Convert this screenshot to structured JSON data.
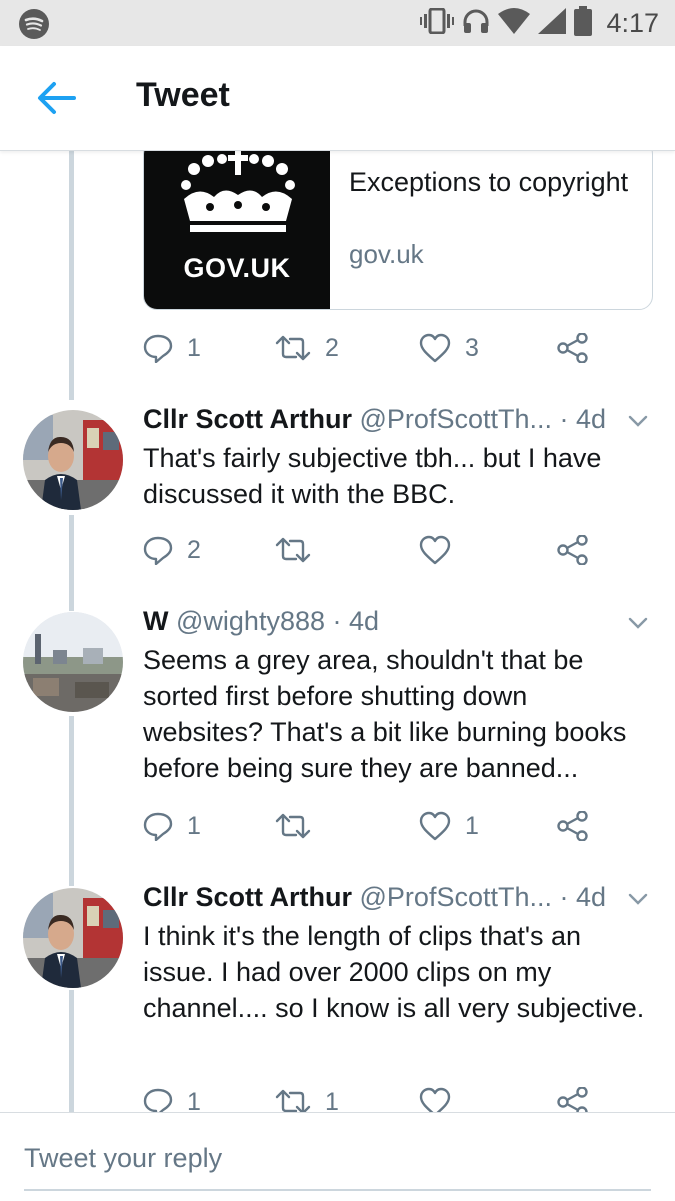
{
  "status_bar": {
    "time": "4:17"
  },
  "app_bar": {
    "title": "Tweet"
  },
  "link_card": {
    "thumbnail_text": "GOV.UK",
    "title": "Exceptions to copyright",
    "domain": "gov.uk",
    "actions": {
      "reply_count": "1",
      "retweet_count": "2",
      "like_count": "3"
    }
  },
  "tweets": [
    {
      "name": "Cllr Scott Arthur",
      "handle": "@ProfScottTh...",
      "time": " · 4d",
      "text": "That's fairly subjective tbh... but I have discussed it with the BBC.",
      "reply_count": "2",
      "retweet_count": "",
      "like_count": ""
    },
    {
      "name": "W",
      "handle": "@wighty888",
      "time": " · 4d",
      "text": "Seems a grey area, shouldn't that be sorted first before shutting down websites? That's a bit like burning books before being sure they are banned...",
      "reply_count": "1",
      "retweet_count": "",
      "like_count": "1"
    },
    {
      "name": "Cllr Scott Arthur",
      "handle": "@ProfScottTh...",
      "time": " · 4d",
      "text": "I think it's the length of clips that's an issue. I had over 2000 clips on my channel.... so I know is all very subjective.",
      "reply_count": "1",
      "retweet_count": "1",
      "like_count": ""
    }
  ],
  "reply_bar": {
    "placeholder": "Tweet your reply"
  },
  "colors": {
    "accent": "#1da1f2",
    "secondary_text": "#657786",
    "thread_line": "#ccd6dd"
  },
  "icons": [
    "spotify-icon",
    "vibrate-icon",
    "headphones-icon",
    "wifi-icon",
    "cell-signal-icon",
    "battery-icon",
    "back-arrow-icon",
    "reply-icon",
    "retweet-icon",
    "like-icon",
    "share-icon",
    "chevron-down-icon"
  ]
}
